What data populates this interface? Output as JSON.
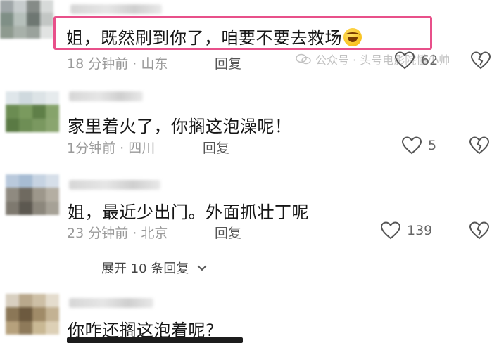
{
  "comments": [
    {
      "text": "姐，既然刷到你了，咱要不要去救场",
      "time": "18 分钟前",
      "location": "山东",
      "reply_label": "回复",
      "likes": "62",
      "highlighted": true,
      "emoji": "rolling-laughing-emoji"
    },
    {
      "text": "家里着火了，你搁这泡澡呢！",
      "time": "1分钟前",
      "location": "四川",
      "reply_label": "回复",
      "likes": "5"
    },
    {
      "text": "姐，最近少出门。外面抓壮丁呢",
      "time": "23 分钟前",
      "location": "北京",
      "reply_label": "回复",
      "likes": "139"
    },
    {
      "text": "你咋还搁这泡着呢?"
    }
  ],
  "expand_replies": "展开 10 条回复",
  "watermark": "公众号 · 头号电影院懂小帅",
  "meta_separator": "·",
  "colors": {
    "highlight_border": "#e8508a",
    "meta_text": "#9a9a9a",
    "body_text": "#161616"
  }
}
